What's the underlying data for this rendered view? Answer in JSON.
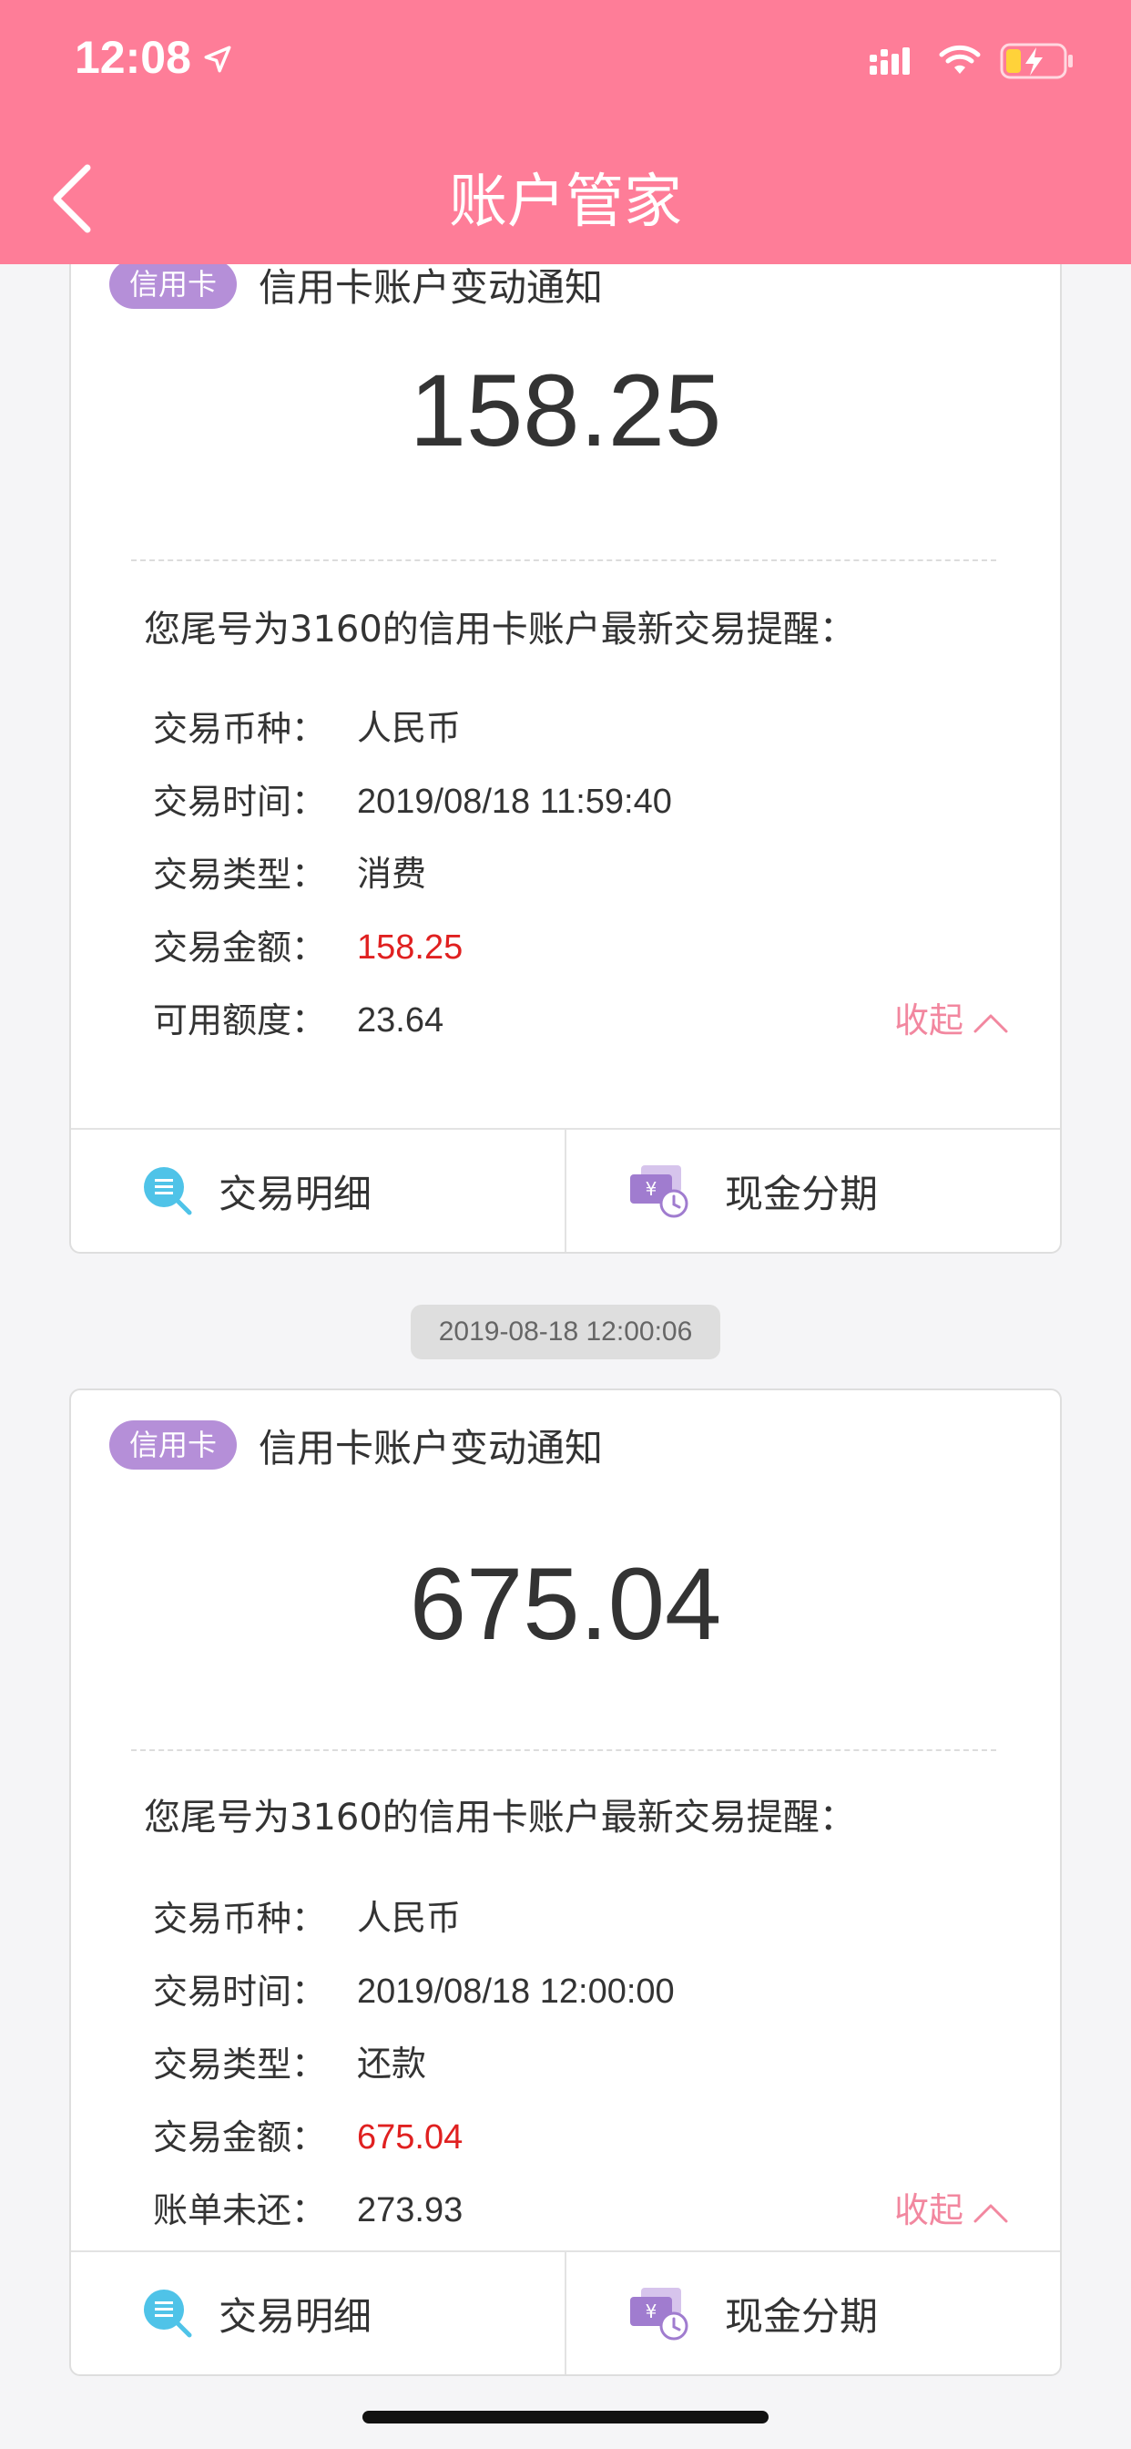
{
  "status": {
    "time": "12:08"
  },
  "nav": {
    "title": "账户管家"
  },
  "colors": {
    "header": "#fe7d98",
    "tag": "#b58fd8",
    "highlight": "#e02020",
    "collapse": "#f2879f"
  },
  "cards": [
    {
      "tag": "信用卡",
      "title": "信用卡账户变动通知",
      "amount": "158.25",
      "intro": "您尾号为3160的信用卡账户最新交易提醒：",
      "rows": [
        {
          "label": "交易币种：",
          "value": "人民币"
        },
        {
          "label": "交易时间：",
          "value": "2019/08/18 11:59:40"
        },
        {
          "label": "交易类型：",
          "value": "消费"
        },
        {
          "label": "交易金额：",
          "value": "158.25"
        },
        {
          "label": "可用额度：",
          "value": "23.64"
        }
      ],
      "collapse": "收起",
      "actions": {
        "detail": "交易明细",
        "installment": "现金分期"
      }
    },
    {
      "tag": "信用卡",
      "title": "信用卡账户变动通知",
      "amount": "675.04",
      "intro": "您尾号为3160的信用卡账户最新交易提醒：",
      "rows": [
        {
          "label": "交易币种：",
          "value": "人民币"
        },
        {
          "label": "交易时间：",
          "value": "2019/08/18 12:00:00"
        },
        {
          "label": "交易类型：",
          "value": "还款"
        },
        {
          "label": "交易金额：",
          "value": "675.04"
        },
        {
          "label": "账单未还：",
          "value": "273.93"
        }
      ],
      "collapse": "收起",
      "actions": {
        "detail": "交易明细",
        "installment": "现金分期"
      }
    }
  ],
  "timestamp": "2019-08-18 12:00:06"
}
